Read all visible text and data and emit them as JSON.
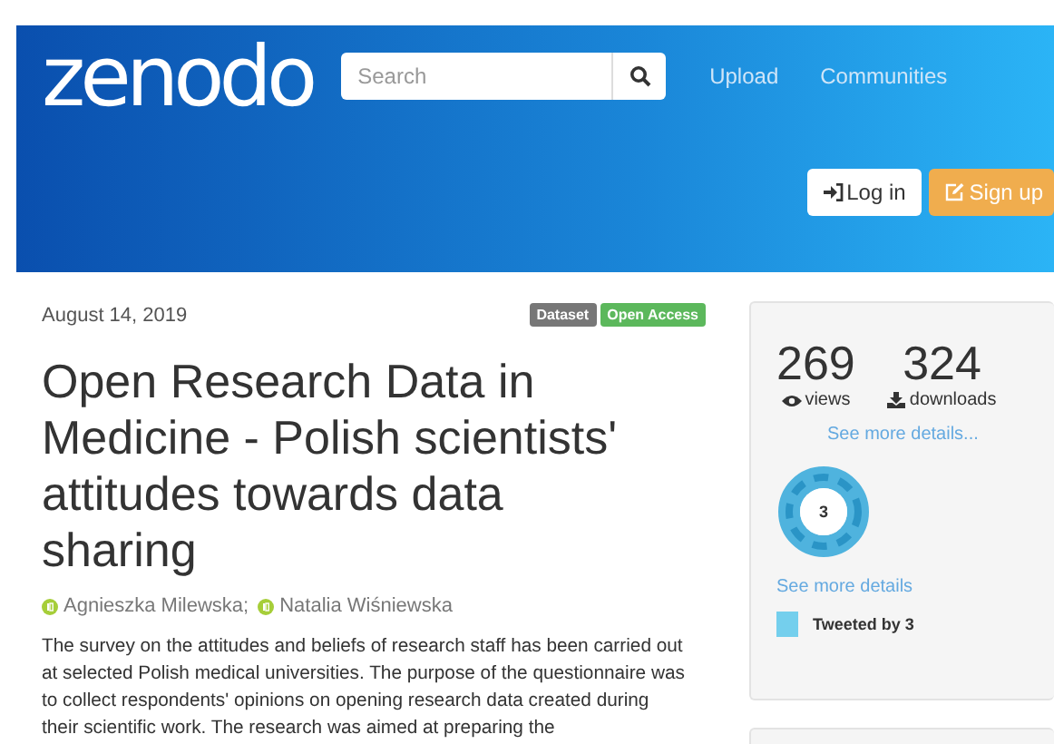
{
  "header": {
    "logo": "zenodo",
    "search": {
      "placeholder": "Search"
    },
    "nav": [
      "Upload",
      "Communities"
    ],
    "login": "Log in",
    "signup": "Sign up"
  },
  "record": {
    "date": "August 14, 2019",
    "badges": [
      {
        "label": "Dataset",
        "kind": "type"
      },
      {
        "label": "Open Access",
        "kind": "access"
      }
    ],
    "title": "Open Research Data in Medicine - Polish scientists' attitudes towards data sharing",
    "authors": [
      "Agnieszka Milewska;",
      "Natalia Wiśniewska"
    ],
    "abstract": "The survey on the attitudes and beliefs of research staff has been carried out at selected Polish medical universities. The purpose of the questionnaire was to collect respondents' opinions on opening research data created during their scientific work. The research was aimed at preparing the"
  },
  "stats": {
    "views": {
      "count": "269",
      "label": "views"
    },
    "downloads": {
      "count": "324",
      "label": "downloads"
    },
    "details_link": "See more details...",
    "altmetric": {
      "score": "3",
      "details_link": "See more details",
      "tweets": "Tweeted by 3"
    }
  }
}
